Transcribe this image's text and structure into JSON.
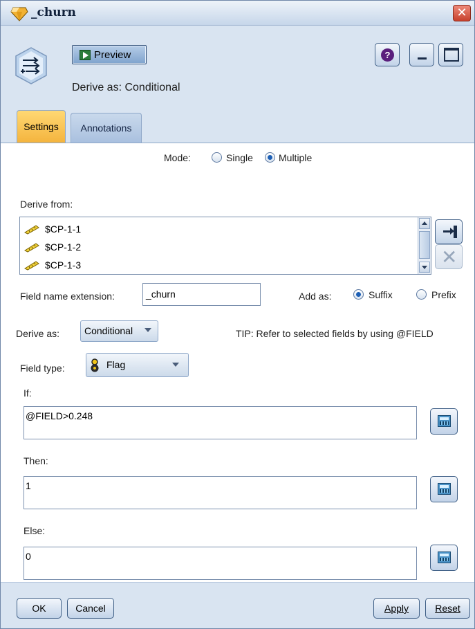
{
  "window": {
    "title": "_churn"
  },
  "toolbar": {
    "preview_label": "Preview"
  },
  "header": {
    "subtitle": "Derive as: Conditional"
  },
  "tabs": [
    {
      "label": "Settings",
      "active": true
    },
    {
      "label": "Annotations",
      "active": false
    }
  ],
  "mode": {
    "label": "Mode:",
    "options": [
      "Single",
      "Multiple"
    ],
    "selected": "Multiple"
  },
  "derive_from": {
    "label": "Derive from:",
    "fields": [
      "$CP-1-1",
      "$CP-1-2",
      "$CP-1-3"
    ]
  },
  "field_name_extension": {
    "label": "Field name extension:",
    "value": "_churn"
  },
  "add_as": {
    "label": "Add as:",
    "options": [
      "Suffix",
      "Prefix"
    ],
    "selected": "Suffix"
  },
  "derive_as": {
    "label": "Derive as:",
    "value": "Conditional",
    "tip": "TIP: Refer to selected fields by using @FIELD"
  },
  "field_type": {
    "label": "Field type:",
    "value": "Flag"
  },
  "if_expr": {
    "label": "If:",
    "value": "@FIELD>0.248"
  },
  "then_expr": {
    "label": "Then:",
    "value": "1"
  },
  "else_expr": {
    "label": "Else:",
    "value": "0"
  },
  "footer": {
    "ok": "OK",
    "cancel": "Cancel",
    "apply": "Apply",
    "reset": "Reset"
  },
  "colors": {
    "active_tab": "#f4b43e",
    "frame": "#d9e4f1",
    "accent": "#1d5fb5"
  },
  "icons": [
    "derive-node-icon",
    "play-icon",
    "help-icon",
    "minimize-icon",
    "maximize-icon",
    "close-icon",
    "ruler-icon",
    "field-picker-icon",
    "delete-icon",
    "flag-icon",
    "calculator-icon"
  ]
}
